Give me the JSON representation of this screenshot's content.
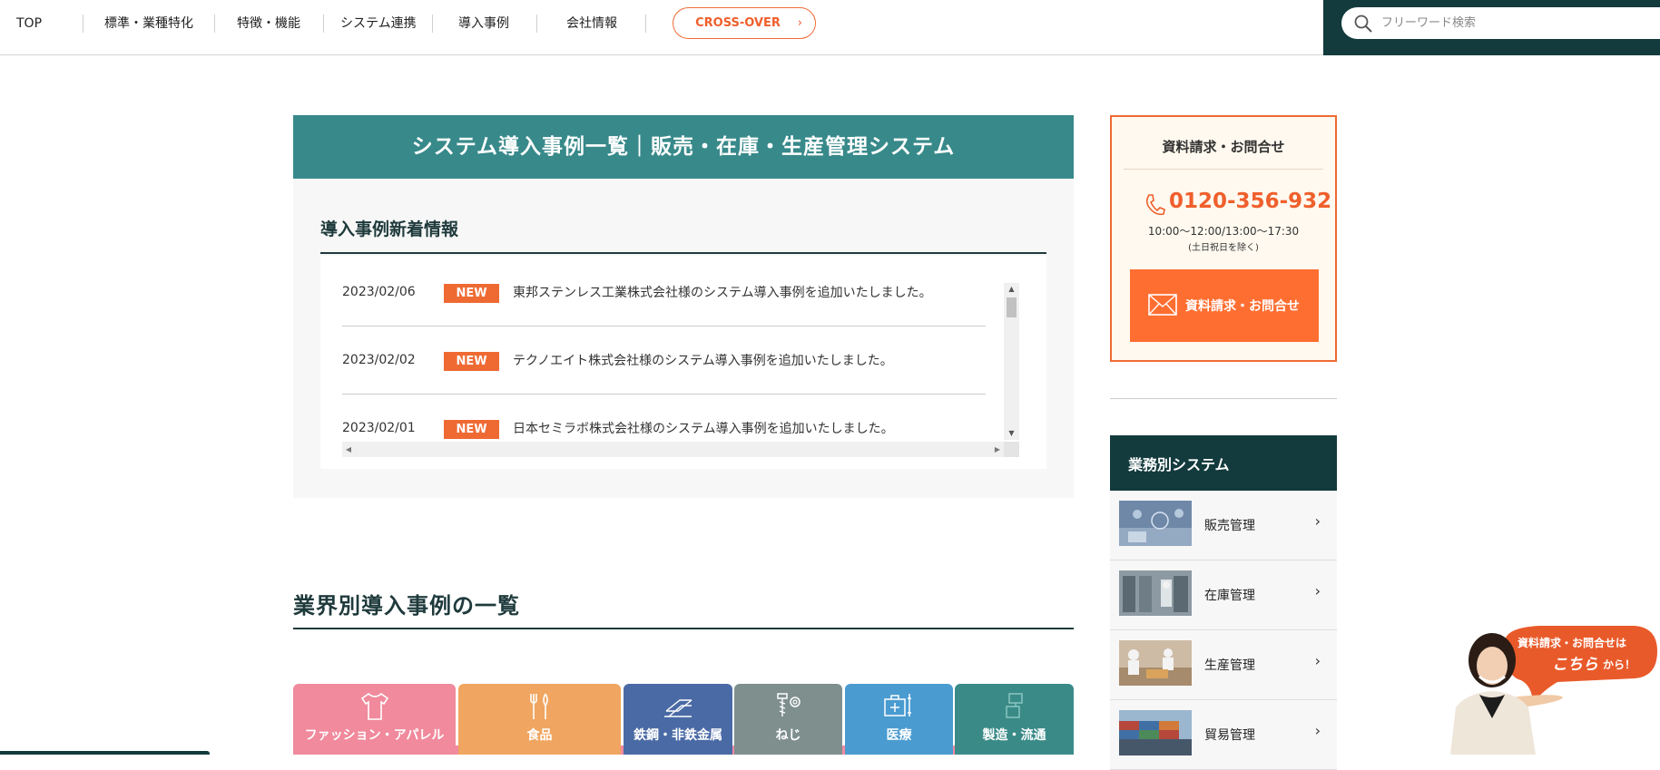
{
  "nav": {
    "items": [
      "TOP",
      "標準・業種特化",
      "特徴・機能",
      "システム連携",
      "導入事例",
      "会社情報"
    ],
    "cross_over": "CROSS-OVER"
  },
  "search": {
    "placeholder": "フリーワード検索"
  },
  "hero": {
    "title": "システム導入事例一覧｜販売・在庫・生産管理システム"
  },
  "news": {
    "heading": "導入事例新着情報",
    "items": [
      {
        "date": "2023/02/06",
        "badge": "NEW",
        "text": "東邦ステンレス工業株式会社様のシステム導入事例を追加いたしました。"
      },
      {
        "date": "2023/02/02",
        "badge": "NEW",
        "text": "テクノエイト株式会社様のシステム導入事例を追加いたしました。"
      },
      {
        "date": "2023/02/01",
        "badge": "NEW",
        "text": "日本セミラボ株式会社様のシステム導入事例を追加いたしました。"
      }
    ]
  },
  "industry": {
    "heading": "業界別導入事例の一覧",
    "tiles": [
      {
        "label": "ファッション・アパレル",
        "color": "#f08a9c",
        "icon": "tshirt-icon"
      },
      {
        "label": "食品",
        "color": "#f0a560",
        "icon": "utensils-icon"
      },
      {
        "label": "鉄鋼・非鉄金属",
        "color": "#4a6aa5",
        "icon": "steel-icon"
      },
      {
        "label": "ねじ",
        "color": "#7e8f8e",
        "icon": "screw-icon"
      },
      {
        "label": "医療",
        "color": "#4a9bd0",
        "icon": "medical-icon"
      },
      {
        "label": "製造・流通",
        "color": "#3a8b88",
        "icon": "factory-icon"
      }
    ]
  },
  "contact": {
    "title": "資料請求・お問合せ",
    "phone": "0120-356-932",
    "hours": "10:00～12:00/13:00～17:30",
    "hours_note": "(土日祝日を除く)",
    "button": "資料請求・お問合せ"
  },
  "systems": {
    "heading": "業務別システム",
    "items": [
      {
        "label": "販売管理"
      },
      {
        "label": "在庫管理"
      },
      {
        "label": "生産管理"
      },
      {
        "label": "貿易管理"
      }
    ]
  },
  "promo": {
    "line1": "資料請求・お問合せは",
    "line2": "こちら",
    "line3": "から！"
  },
  "colors": {
    "accent": "#ef5f2c",
    "teal": "#38898a",
    "dark": "#133a3d"
  }
}
